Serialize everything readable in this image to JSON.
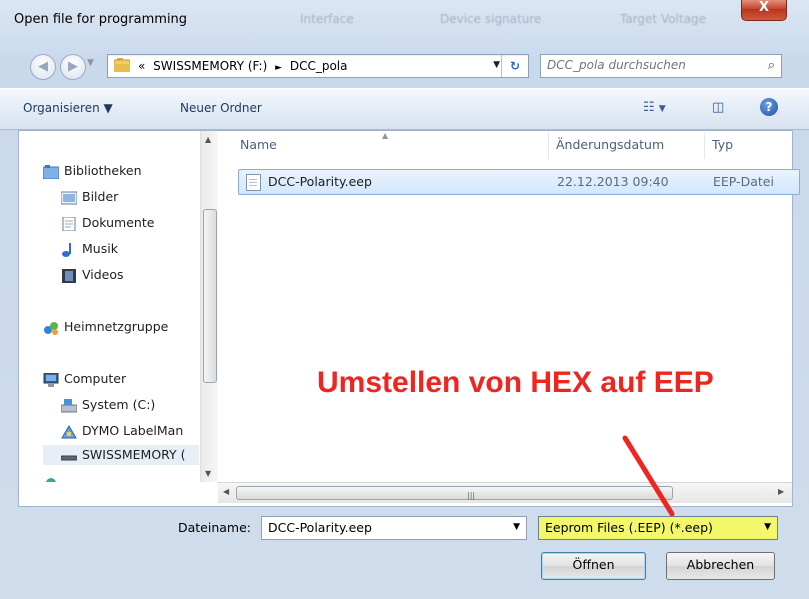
{
  "window": {
    "title": "Open file for programming",
    "close_glyph": "X",
    "background_tabs": [
      "Interface",
      "Device signature",
      "Target Voltage"
    ]
  },
  "address": {
    "overflow": "«",
    "crumbs": [
      "SWISSMEMORY (F:)",
      "►",
      "DCC_pola"
    ],
    "search_placeholder": "DCC_pola durchsuchen"
  },
  "toolbar": {
    "organize": "Organisieren ▼",
    "new_folder": "Neuer Ordner"
  },
  "nav_tree": {
    "items": [
      {
        "label": "Bibliotheken",
        "icon": "libraries-icon"
      },
      {
        "label": "Bilder",
        "icon": "pictures-icon"
      },
      {
        "label": "Dokumente",
        "icon": "documents-icon"
      },
      {
        "label": "Musik",
        "icon": "music-icon"
      },
      {
        "label": "Videos",
        "icon": "videos-icon"
      },
      {
        "label": "Heimnetzgruppe",
        "icon": "homegroup-icon"
      },
      {
        "label": "Computer",
        "icon": "computer-icon"
      },
      {
        "label": "System (C:)",
        "icon": "system-drive-icon"
      },
      {
        "label": "DYMO LabelMan",
        "icon": "dymo-drive-icon"
      },
      {
        "label": "SWISSMEMORY (",
        "icon": "usb-drive-icon"
      }
    ]
  },
  "columns": {
    "name": "Name",
    "date": "Änderungsdatum",
    "type": "Typ"
  },
  "files": [
    {
      "name": "DCC-Polarity.eep",
      "date": "22.12.2013 09:40",
      "type": "EEP-Datei"
    }
  ],
  "annotation": {
    "text": "Umstellen von HEX auf EEP",
    "color": "#f0251f"
  },
  "bottom": {
    "filename_label": "Dateiname:",
    "filename_value": "DCC-Polarity.eep",
    "filter_value": "Eeprom Files (.EEP) (*.eep)",
    "filter_highlight": "#f3f86a",
    "open_button": "Öffnen",
    "cancel_button": "Abbrechen"
  },
  "colors": {
    "accent": "#2c65b4",
    "selection": "#d4e7fb"
  }
}
